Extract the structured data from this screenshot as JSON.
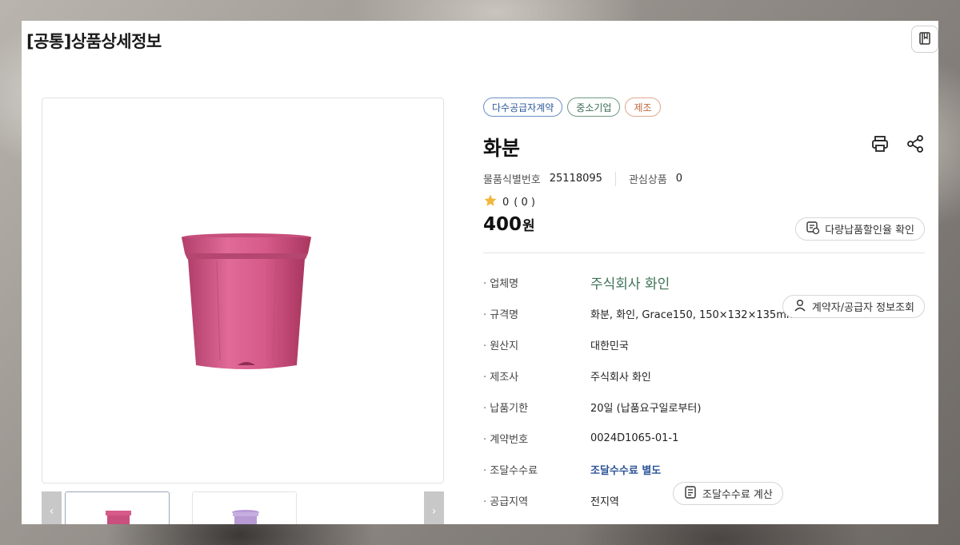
{
  "page": {
    "title": "[공통]상품상세정보"
  },
  "badges": [
    {
      "label": "다수공급자계약",
      "color": "#2f5a9a"
    },
    {
      "label": "중소기업",
      "color": "#3b6b4f"
    },
    {
      "label": "제조",
      "color": "#c0683e"
    }
  ],
  "product": {
    "name": "화분",
    "id_label": "물품식별번호",
    "id_value": "25118095",
    "interest_label": "관심상품",
    "interest_value": "0",
    "rating_score": "0",
    "rating_count": "( 0 )",
    "price_value": "400",
    "price_unit": "원"
  },
  "buttons": {
    "volume_discount": "다량납품할인율 확인",
    "contractor_info": "계약자/공급자 정보조회",
    "fee_calc": "조달수수료 계산"
  },
  "details": [
    {
      "label": "업체명",
      "value": "주식회사 화인"
    },
    {
      "label": "규격명",
      "value": "화분, 화인, Grace150, 150×132×135mm"
    },
    {
      "label": "원산지",
      "value": "대한민국"
    },
    {
      "label": "제조사",
      "value": "주식회사 화인"
    },
    {
      "label": "납품기한",
      "value": "20일 (납품요구일로부터)"
    },
    {
      "label": "계약번호",
      "value": "0024D1065-01-1"
    },
    {
      "label": "조달수수료",
      "value": "조달수수료 별도"
    },
    {
      "label": "공급지역",
      "value": "전지역"
    }
  ],
  "icons": {
    "bookmark": "book-icon",
    "print": "printer-icon",
    "share": "share-icon",
    "star": "star-icon",
    "discount": "discount-icon",
    "person": "person-icon",
    "calculator": "calculator-icon",
    "prev": "chevron-left-icon",
    "next": "chevron-right-icon"
  },
  "colors": {
    "pot": "#d65a8a",
    "company_text": "#3f7356",
    "fee_link": "#2d5596",
    "star": "#f2b63b"
  }
}
